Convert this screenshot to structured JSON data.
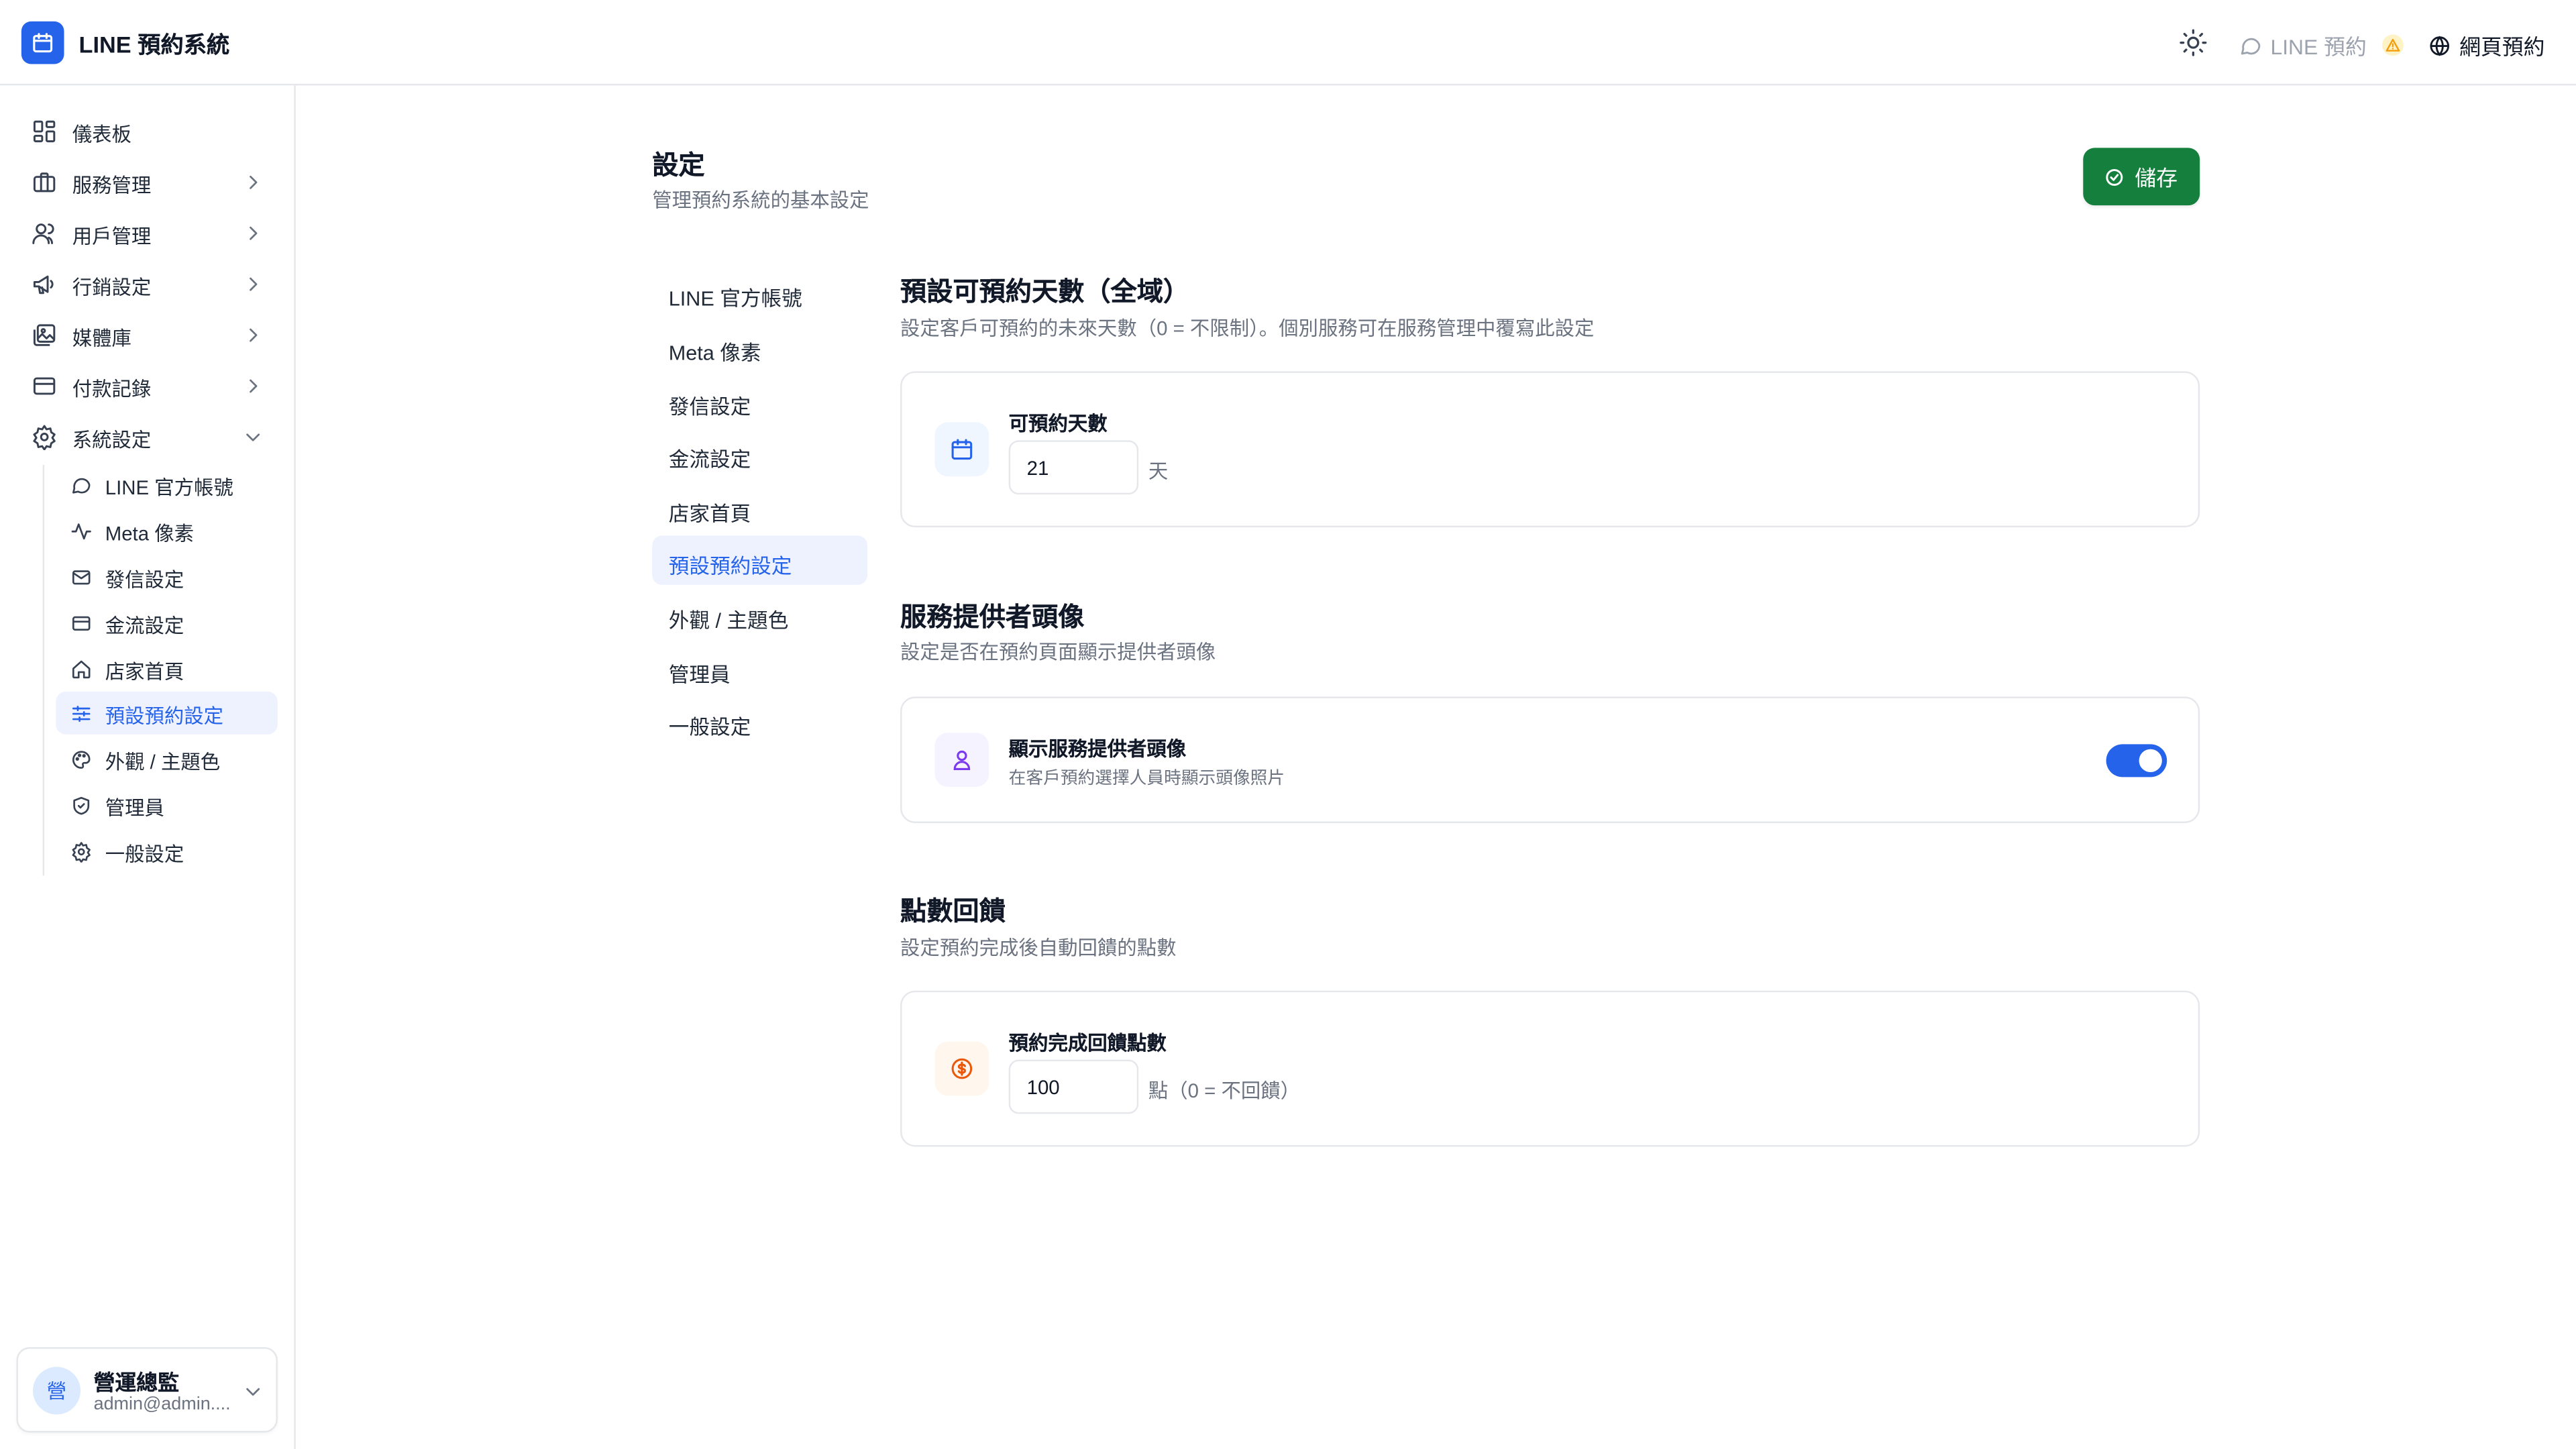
{
  "app": {
    "title": "LINE 預約系統"
  },
  "header": {
    "line_status": "LINE 預約",
    "web_booking": "網頁預約"
  },
  "sidebar": {
    "items": [
      {
        "label": "儀表板",
        "icon": "dashboard-icon"
      },
      {
        "label": "服務管理",
        "icon": "briefcase-icon"
      },
      {
        "label": "用戶管理",
        "icon": "users-icon"
      },
      {
        "label": "行銷設定",
        "icon": "megaphone-icon"
      },
      {
        "label": "媒體庫",
        "icon": "image-icon"
      },
      {
        "label": "付款記錄",
        "icon": "credit-card-icon"
      },
      {
        "label": "系統設定",
        "icon": "settings-icon"
      }
    ],
    "sub_items": [
      {
        "label": "LINE 官方帳號"
      },
      {
        "label": "Meta 像素"
      },
      {
        "label": "發信設定"
      },
      {
        "label": "金流設定"
      },
      {
        "label": "店家首頁"
      },
      {
        "label": "預設預約設定",
        "active": true
      },
      {
        "label": "外觀 / 主題色"
      },
      {
        "label": "管理員"
      },
      {
        "label": "一般設定"
      }
    ]
  },
  "user": {
    "avatar_char": "營",
    "name": "營運總監",
    "email": "admin@admin...."
  },
  "page": {
    "title": "設定",
    "subtitle": "管理預約系統的基本設定",
    "save_label": "儲存"
  },
  "tabs": [
    {
      "label": "LINE 官方帳號"
    },
    {
      "label": "Meta 像素"
    },
    {
      "label": "發信設定"
    },
    {
      "label": "金流設定"
    },
    {
      "label": "店家首頁"
    },
    {
      "label": "預設預約設定",
      "active": true
    },
    {
      "label": "外觀 / 主題色"
    },
    {
      "label": "管理員"
    },
    {
      "label": "一般設定"
    }
  ],
  "sections": {
    "days": {
      "title": "預設可預約天數（全域）",
      "description": "設定客戶可預約的未來天數（0 = 不限制）。個別服務可在服務管理中覆寫此設定",
      "field_label": "可預約天數",
      "value": "21",
      "unit": "天"
    },
    "avatar": {
      "title": "服務提供者頭像",
      "description": "設定是否在預約頁面顯示提供者頭像",
      "field_label": "顯示服務提供者頭像",
      "hint": "在客戶預約選擇人員時顯示頭像照片",
      "enabled": true
    },
    "points": {
      "title": "點數回饋",
      "description": "設定預約完成後自動回饋的點數",
      "field_label": "預約完成回饋點數",
      "value": "100",
      "unit": "點（0 = 不回饋）"
    }
  },
  "colors": {
    "primary": "#2563eb",
    "save": "#15803d",
    "active_bg": "#eef2ff"
  }
}
